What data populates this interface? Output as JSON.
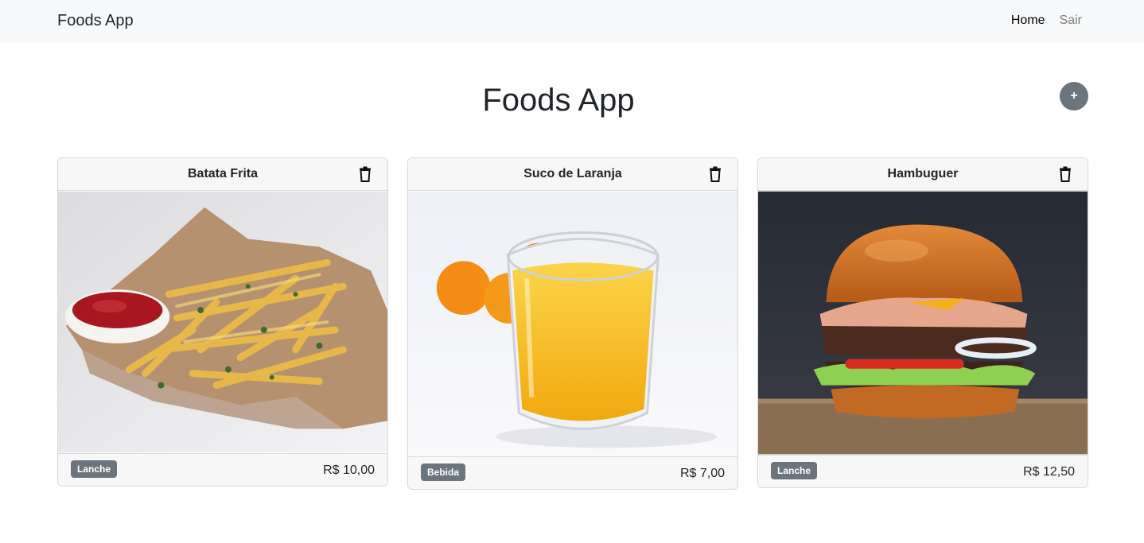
{
  "navbar": {
    "brand": "Foods App",
    "links": [
      "Home",
      "Sair"
    ]
  },
  "page": {
    "title": "Foods App",
    "add_label": "+"
  },
  "cards": [
    {
      "title": "Batata Frita",
      "category": "Lanche",
      "price": "R$ 10,00"
    },
    {
      "title": "Suco de Laranja",
      "category": "Bebida",
      "price": "R$ 7,00"
    },
    {
      "title": "Hambuguer",
      "category": "Lanche",
      "price": "R$ 12,50"
    }
  ]
}
